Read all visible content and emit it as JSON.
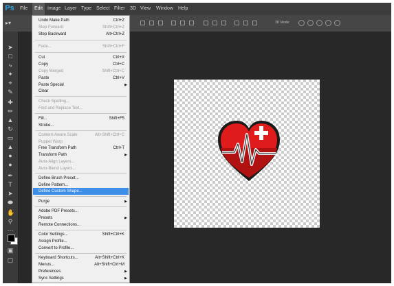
{
  "app": {
    "logo": "Ps"
  },
  "menubar": {
    "items": [
      "File",
      "Edit",
      "Image",
      "Layer",
      "Type",
      "Select",
      "Filter",
      "3D",
      "View",
      "Window",
      "Help"
    ],
    "active": "Edit"
  },
  "options_bar": {
    "mode_label": "3D Mode:"
  },
  "edit_menu": {
    "items": [
      {
        "label": "Undo Make Path",
        "shortcut": "Ctrl+Z",
        "state": "enabled"
      },
      {
        "label": "Step Forward",
        "shortcut": "Shift+Ctrl+Z",
        "state": "disabled"
      },
      {
        "label": "Step Backward",
        "shortcut": "Alt+Ctrl+Z",
        "state": "enabled"
      },
      {
        "label": "Fade...",
        "shortcut": "Shift+Ctrl+F",
        "state": "disabled"
      },
      {
        "label": "Cut",
        "shortcut": "Ctrl+X",
        "state": "enabled"
      },
      {
        "label": "Copy",
        "shortcut": "Ctrl+C",
        "state": "enabled"
      },
      {
        "label": "Copy Merged",
        "shortcut": "Shift+Ctrl+C",
        "state": "disabled"
      },
      {
        "label": "Paste",
        "shortcut": "Ctrl+V",
        "state": "enabled"
      },
      {
        "label": "Paste Special",
        "submenu": true,
        "state": "enabled"
      },
      {
        "label": "Clear",
        "state": "enabled"
      },
      {
        "label": "Check Spelling...",
        "state": "disabled"
      },
      {
        "label": "Find and Replace Text...",
        "state": "disabled"
      },
      {
        "label": "Fill...",
        "shortcut": "Shift+F5",
        "state": "enabled"
      },
      {
        "label": "Stroke...",
        "state": "enabled"
      },
      {
        "label": "Content-Aware Scale",
        "shortcut": "Alt+Shift+Ctrl+C",
        "state": "disabled"
      },
      {
        "label": "Puppet Warp",
        "state": "disabled"
      },
      {
        "label": "Free Transform Path",
        "shortcut": "Ctrl+T",
        "state": "enabled"
      },
      {
        "label": "Transform Path",
        "submenu": true,
        "state": "enabled"
      },
      {
        "label": "Auto-Align Layers...",
        "state": "disabled"
      },
      {
        "label": "Auto-Blend Layers...",
        "state": "disabled"
      },
      {
        "label": "Define Brush Preset...",
        "state": "enabled"
      },
      {
        "label": "Define Pattern...",
        "state": "enabled"
      },
      {
        "label": "Define Custom Shape...",
        "state": "highlighted"
      },
      {
        "label": "Purge",
        "submenu": true,
        "state": "enabled"
      },
      {
        "label": "Adobe PDF Presets...",
        "state": "enabled"
      },
      {
        "label": "Presets",
        "submenu": true,
        "state": "enabled"
      },
      {
        "label": "Remote Connections...",
        "state": "enabled"
      },
      {
        "label": "Color Settings...",
        "shortcut": "Shift+Ctrl+K",
        "state": "enabled"
      },
      {
        "label": "Assign Profile...",
        "state": "enabled"
      },
      {
        "label": "Convert to Profile...",
        "state": "enabled"
      },
      {
        "label": "Keyboard Shortcuts...",
        "shortcut": "Alt+Shift+Ctrl+K",
        "state": "enabled"
      },
      {
        "label": "Menus...",
        "shortcut": "Alt+Shift+Ctrl+M",
        "state": "enabled"
      },
      {
        "label": "Preferences",
        "submenu": true,
        "state": "enabled"
      },
      {
        "label": "Sync Settings",
        "submenu": true,
        "state": "enabled"
      }
    ]
  },
  "canvas": {
    "image": "red-heart-with-cross-and-heartbeat-icon"
  },
  "colors": {
    "app_bg": "#282828",
    "menu_bg": "#f0f0f0",
    "highlight": "#3d8ee6",
    "heart_red": "#e01b1b",
    "logo_blue": "#2fa4e7"
  }
}
